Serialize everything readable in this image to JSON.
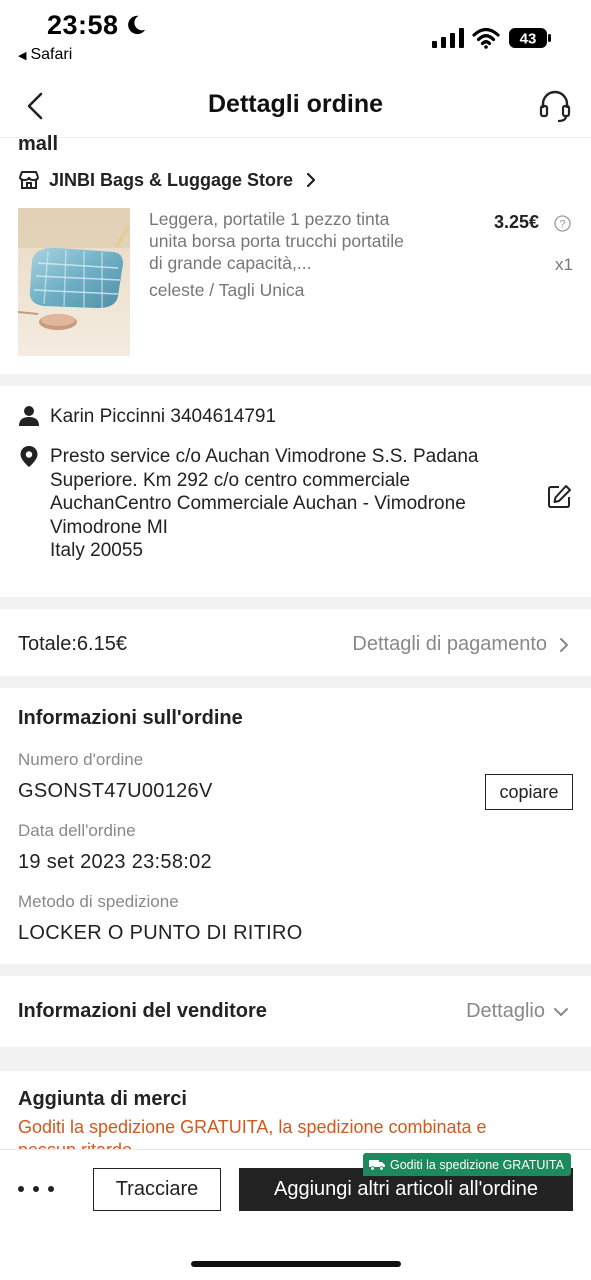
{
  "status_bar": {
    "time": "23:58",
    "back_app": "Safari",
    "battery": "43"
  },
  "nav": {
    "title": "Dettagli ordine",
    "back_icon": "chevron-left-icon",
    "support_icon": "headset-icon"
  },
  "store": {
    "partial_heading": "mall",
    "name": "JINBI Bags & Luggage Store",
    "product": {
      "title": "Leggera, portatile 1 pezzo tinta unita borsa porta trucchi portatile di grande capacità,...",
      "variant": "celeste / Tagli Unica",
      "price": "3.25€",
      "quantity": "x1"
    }
  },
  "address": {
    "recipient": "Karin Piccinni 3404614791",
    "lines": [
      "Presto service c/o Auchan Vimodrone S.S. Padana",
      "Superiore. Km 292 c/o centro commerciale",
      "AuchanCentro Commerciale Auchan - Vimodrone",
      "Vimodrone MI",
      "Italy 20055"
    ]
  },
  "total": {
    "label": "Totale:6.15€",
    "payment_link": "Dettagli di pagamento"
  },
  "order_info": {
    "title": "Informazioni sull'ordine",
    "order_number_label": "Numero d'ordine",
    "order_number": "GSONST47U00126V",
    "copy_label": "copiare",
    "date_label": "Data dell'ordine",
    "date": "19 set 2023 23:58:02",
    "shipping_label": "Metodo di spedizione",
    "shipping": "LOCKER O PUNTO DI RITIRO"
  },
  "seller": {
    "title": "Informazioni del venditore",
    "detail_label": "Dettaglio"
  },
  "add_goods": {
    "title": "Aggiunta di merci",
    "promo": "Goditi la spedizione GRATUITA, la spedizione combinata e nessun ritardo"
  },
  "bottom_bar": {
    "track_label": "Tracciare",
    "add_label": "Aggiungi altri articoli all'ordine",
    "badge": "Goditi la spedizione GRATUITA"
  },
  "colors": {
    "accent_orange": "#d2581c",
    "badge_green": "#1c8a5c",
    "primary_dark": "#222222"
  }
}
